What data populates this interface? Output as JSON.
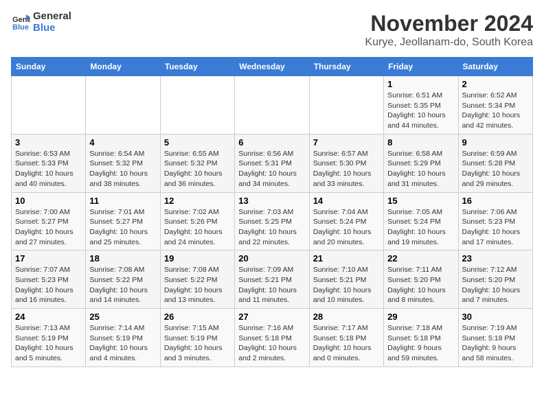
{
  "header": {
    "logo_line1": "General",
    "logo_line2": "Blue",
    "month_title": "November 2024",
    "subtitle": "Kurye, Jeollanam-do, South Korea"
  },
  "days_of_week": [
    "Sunday",
    "Monday",
    "Tuesday",
    "Wednesday",
    "Thursday",
    "Friday",
    "Saturday"
  ],
  "weeks": [
    [
      {
        "day": "",
        "info": ""
      },
      {
        "day": "",
        "info": ""
      },
      {
        "day": "",
        "info": ""
      },
      {
        "day": "",
        "info": ""
      },
      {
        "day": "",
        "info": ""
      },
      {
        "day": "1",
        "info": "Sunrise: 6:51 AM\nSunset: 5:35 PM\nDaylight: 10 hours\nand 44 minutes."
      },
      {
        "day": "2",
        "info": "Sunrise: 6:52 AM\nSunset: 5:34 PM\nDaylight: 10 hours\nand 42 minutes."
      }
    ],
    [
      {
        "day": "3",
        "info": "Sunrise: 6:53 AM\nSunset: 5:33 PM\nDaylight: 10 hours\nand 40 minutes."
      },
      {
        "day": "4",
        "info": "Sunrise: 6:54 AM\nSunset: 5:32 PM\nDaylight: 10 hours\nand 38 minutes."
      },
      {
        "day": "5",
        "info": "Sunrise: 6:55 AM\nSunset: 5:32 PM\nDaylight: 10 hours\nand 36 minutes."
      },
      {
        "day": "6",
        "info": "Sunrise: 6:56 AM\nSunset: 5:31 PM\nDaylight: 10 hours\nand 34 minutes."
      },
      {
        "day": "7",
        "info": "Sunrise: 6:57 AM\nSunset: 5:30 PM\nDaylight: 10 hours\nand 33 minutes."
      },
      {
        "day": "8",
        "info": "Sunrise: 6:58 AM\nSunset: 5:29 PM\nDaylight: 10 hours\nand 31 minutes."
      },
      {
        "day": "9",
        "info": "Sunrise: 6:59 AM\nSunset: 5:28 PM\nDaylight: 10 hours\nand 29 minutes."
      }
    ],
    [
      {
        "day": "10",
        "info": "Sunrise: 7:00 AM\nSunset: 5:27 PM\nDaylight: 10 hours\nand 27 minutes."
      },
      {
        "day": "11",
        "info": "Sunrise: 7:01 AM\nSunset: 5:27 PM\nDaylight: 10 hours\nand 25 minutes."
      },
      {
        "day": "12",
        "info": "Sunrise: 7:02 AM\nSunset: 5:26 PM\nDaylight: 10 hours\nand 24 minutes."
      },
      {
        "day": "13",
        "info": "Sunrise: 7:03 AM\nSunset: 5:25 PM\nDaylight: 10 hours\nand 22 minutes."
      },
      {
        "day": "14",
        "info": "Sunrise: 7:04 AM\nSunset: 5:24 PM\nDaylight: 10 hours\nand 20 minutes."
      },
      {
        "day": "15",
        "info": "Sunrise: 7:05 AM\nSunset: 5:24 PM\nDaylight: 10 hours\nand 19 minutes."
      },
      {
        "day": "16",
        "info": "Sunrise: 7:06 AM\nSunset: 5:23 PM\nDaylight: 10 hours\nand 17 minutes."
      }
    ],
    [
      {
        "day": "17",
        "info": "Sunrise: 7:07 AM\nSunset: 5:23 PM\nDaylight: 10 hours\nand 16 minutes."
      },
      {
        "day": "18",
        "info": "Sunrise: 7:08 AM\nSunset: 5:22 PM\nDaylight: 10 hours\nand 14 minutes."
      },
      {
        "day": "19",
        "info": "Sunrise: 7:08 AM\nSunset: 5:22 PM\nDaylight: 10 hours\nand 13 minutes."
      },
      {
        "day": "20",
        "info": "Sunrise: 7:09 AM\nSunset: 5:21 PM\nDaylight: 10 hours\nand 11 minutes."
      },
      {
        "day": "21",
        "info": "Sunrise: 7:10 AM\nSunset: 5:21 PM\nDaylight: 10 hours\nand 10 minutes."
      },
      {
        "day": "22",
        "info": "Sunrise: 7:11 AM\nSunset: 5:20 PM\nDaylight: 10 hours\nand 8 minutes."
      },
      {
        "day": "23",
        "info": "Sunrise: 7:12 AM\nSunset: 5:20 PM\nDaylight: 10 hours\nand 7 minutes."
      }
    ],
    [
      {
        "day": "24",
        "info": "Sunrise: 7:13 AM\nSunset: 5:19 PM\nDaylight: 10 hours\nand 5 minutes."
      },
      {
        "day": "25",
        "info": "Sunrise: 7:14 AM\nSunset: 5:19 PM\nDaylight: 10 hours\nand 4 minutes."
      },
      {
        "day": "26",
        "info": "Sunrise: 7:15 AM\nSunset: 5:19 PM\nDaylight: 10 hours\nand 3 minutes."
      },
      {
        "day": "27",
        "info": "Sunrise: 7:16 AM\nSunset: 5:18 PM\nDaylight: 10 hours\nand 2 minutes."
      },
      {
        "day": "28",
        "info": "Sunrise: 7:17 AM\nSunset: 5:18 PM\nDaylight: 10 hours\nand 0 minutes."
      },
      {
        "day": "29",
        "info": "Sunrise: 7:18 AM\nSunset: 5:18 PM\nDaylight: 9 hours\nand 59 minutes."
      },
      {
        "day": "30",
        "info": "Sunrise: 7:19 AM\nSunset: 5:18 PM\nDaylight: 9 hours\nand 58 minutes."
      }
    ]
  ]
}
